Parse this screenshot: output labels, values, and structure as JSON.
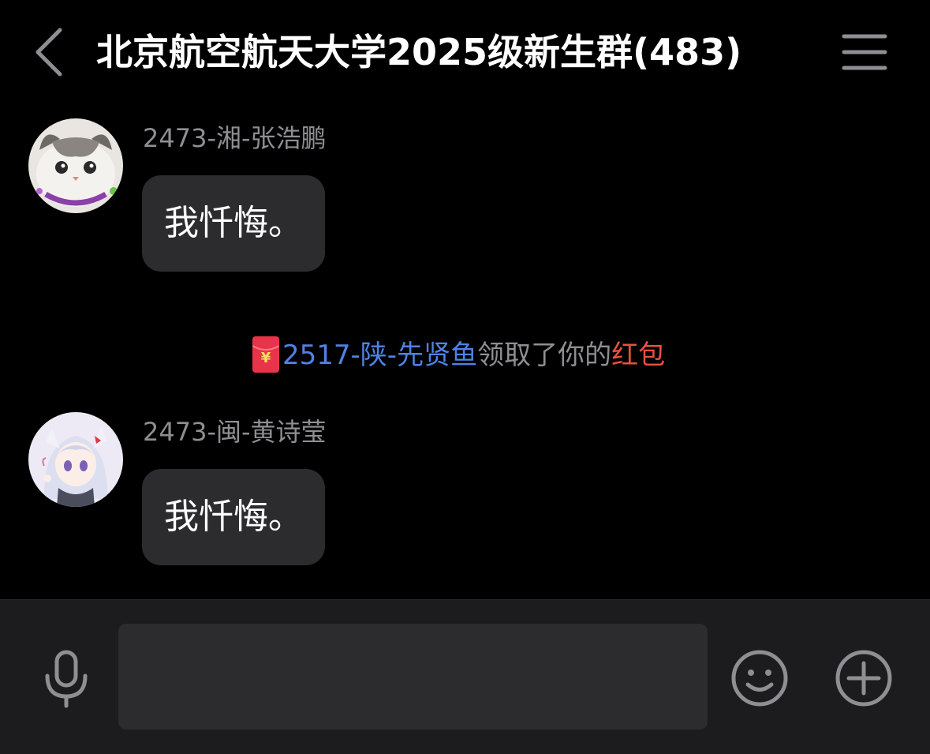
{
  "header": {
    "title": "北京航空航天大学2025级新生群(483)",
    "back_icon": "chevron-left-icon",
    "menu_icon": "hamburger-menu-icon"
  },
  "messages": [
    {
      "sender": "2473-湘-张浩鹏",
      "text": "我忏悔。",
      "avatar": "cat-photo-avatar"
    },
    {
      "sender": "2473-闽-黄诗莹",
      "text": "我忏悔。",
      "avatar": "anime-girl-avatar"
    }
  ],
  "system_notice": {
    "icon": "red-packet-icon",
    "user": "2517-陕-先贤鱼",
    "middle": "领取了你的",
    "link": "红包"
  },
  "input_bar": {
    "voice_icon": "microphone-icon",
    "input_value": "",
    "emoji_icon": "smiley-face-icon",
    "more_icon": "plus-circle-icon"
  },
  "colors": {
    "background": "#000000",
    "bubble": "#2c2c2e",
    "sender_gray": "#8e8e93",
    "link_blue": "#4f82e6",
    "red_packet": "#e8513f",
    "input_bar": "#1c1c1e"
  }
}
